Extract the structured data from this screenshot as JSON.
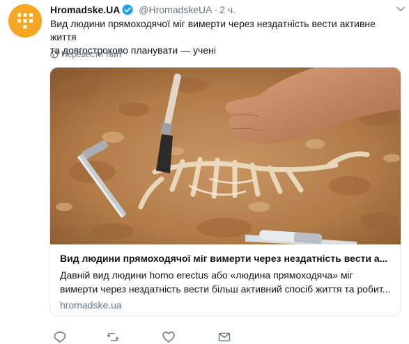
{
  "tweet": {
    "author_name": "Hromadske.UA",
    "handle": "@HromadskeUA",
    "separator": "·",
    "time": "2 ч.",
    "text_line1": "Вид людини прямоходячої міг вимерти через нездатність вести активне життя",
    "text_line2": "та довгостроково планувати — учені",
    "translate_label": "Перевести твит"
  },
  "card": {
    "title": "Вид людини прямоходячої міг вимерти через нездатність вести а...",
    "desc_line1": "Давній вид людини homo erectus або «людина прямоходяча» міг",
    "desc_line2": "вимерти через нездатність вести більш активний спосіб життя та робит...",
    "domain": "hromadske.ua"
  },
  "colors": {
    "brand_avatar": "#f5a623",
    "verified": "#1da1f2",
    "muted": "#657786",
    "border": "#e1e8ed",
    "soil": "#b9834f"
  },
  "icons": [
    "hromadske-logo-icon",
    "verified-badge-icon",
    "caret-down-icon",
    "globe-icon",
    "reply-icon",
    "retweet-icon",
    "like-icon",
    "direct-message-icon"
  ]
}
